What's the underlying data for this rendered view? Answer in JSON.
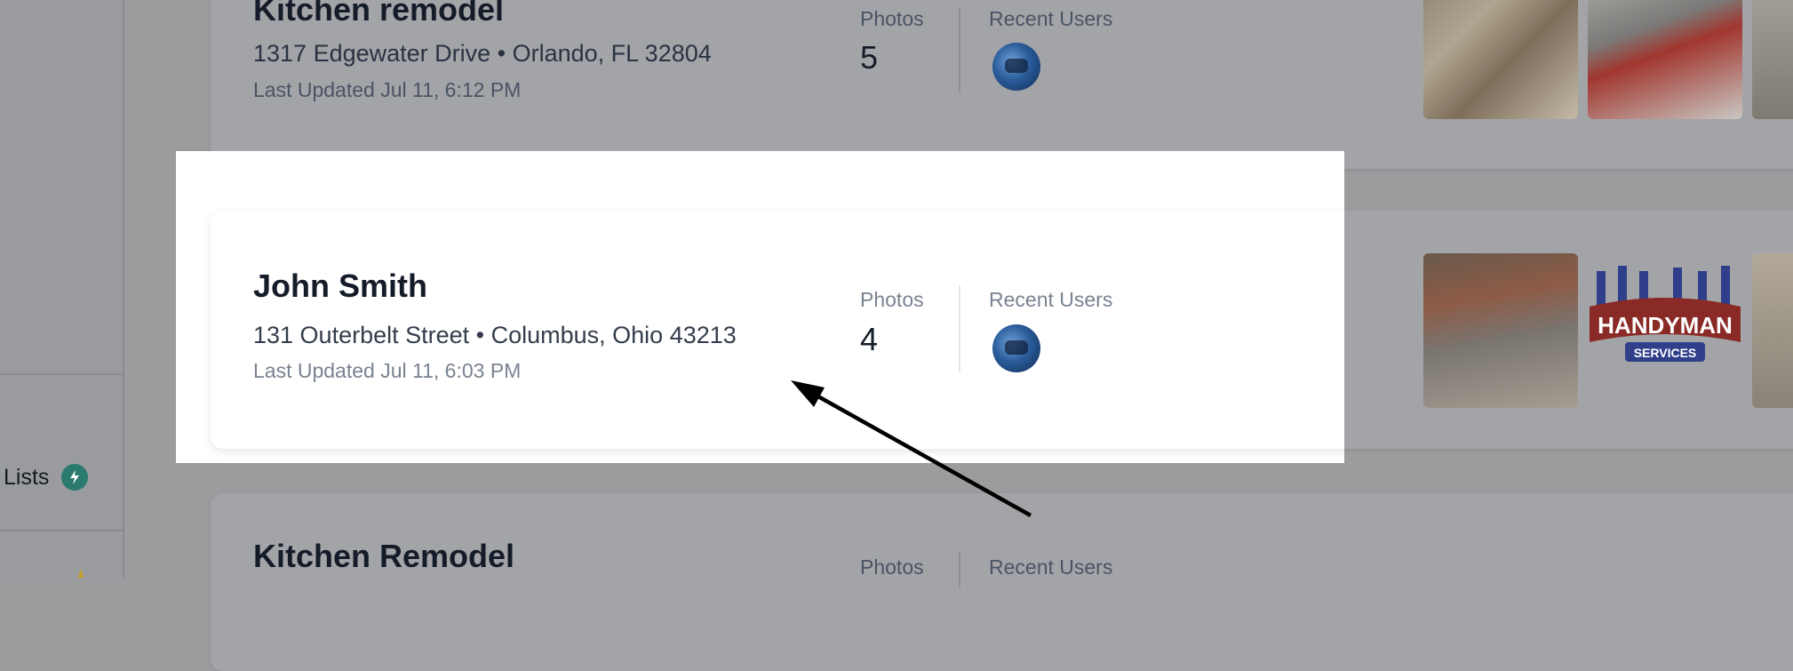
{
  "sidebar": {
    "lists_label": "Lists",
    "lists_badge_icon": "bolt-icon"
  },
  "projects": [
    {
      "title": "Kitchen remodel",
      "address": "1317 Edgewater Drive • Orlando, FL 32804",
      "updated": "Last Updated Jul 11, 6:12 PM",
      "photos_label": "Photos",
      "photos_count": "5",
      "recent_users_label": "Recent Users"
    },
    {
      "title": "John Smith",
      "address": "131 Outerbelt Street • Columbus, Ohio 43213",
      "updated": "Last Updated Jul 11, 6:03 PM",
      "photos_label": "Photos",
      "photos_count": "4",
      "recent_users_label": "Recent Users"
    },
    {
      "title": "Kitchen Remodel",
      "photos_label": "Photos",
      "recent_users_label": "Recent Users"
    }
  ],
  "thumbnail_logo_text": [
    "HANDYMAN",
    "SERVICES"
  ],
  "colors": {
    "overlay_background": "#9b9c9e",
    "highlight_background": "#ffffff",
    "badge": "#2b7a6f",
    "arrow": "#000000"
  }
}
